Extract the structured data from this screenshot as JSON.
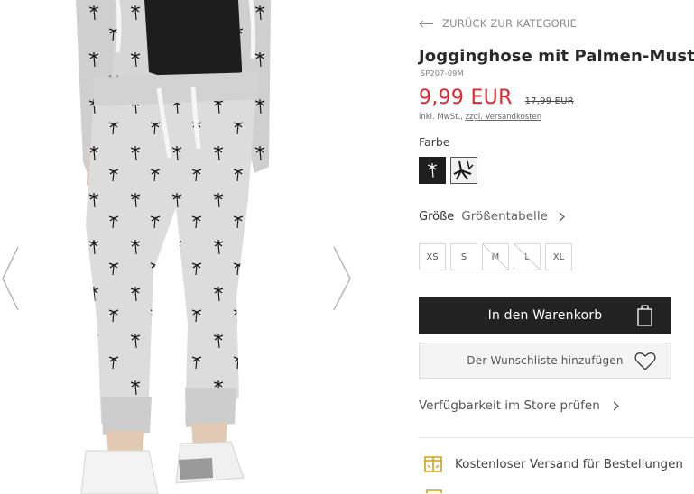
{
  "gallery": {
    "prev_icon": "chevron-left-icon",
    "next_icon": "chevron-right-icon"
  },
  "product": {
    "back_label": "ZURÜCK ZUR KATEGORIE",
    "title": "Jogginghose mit Palmen-Muster",
    "sku": "SP207-09M",
    "price": "9,99 EUR",
    "old_price": "17,99 EUR",
    "tax_prefix": "inkl. MwSt.,",
    "shipping_link": "zzgl. Versandkosten",
    "color_label": "Farbe",
    "size_label": "Größe",
    "size_chart_label": "Größentabelle",
    "sizes": [
      {
        "label": "XS",
        "available": true
      },
      {
        "label": "S",
        "available": true
      },
      {
        "label": "M",
        "available": false
      },
      {
        "label": "L",
        "available": false
      },
      {
        "label": "XL",
        "available": true
      }
    ],
    "cart_label": "In den Warenkorb",
    "wishlist_label": "Der Wunschliste hinzufügen",
    "store_label": "Verfügbarkeit im Store prüfen",
    "shipping_info": "Kostenloser Versand für Bestellungen"
  },
  "colors": {
    "price_red": "#e0262e",
    "button_dark": "#222222",
    "accent_gold": "#d4a017"
  }
}
